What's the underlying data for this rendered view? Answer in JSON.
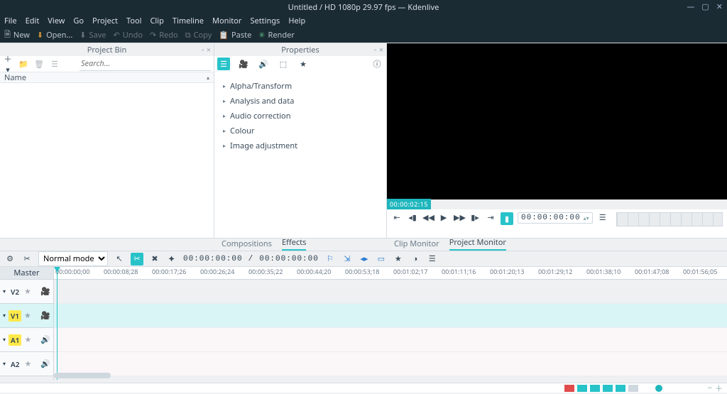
{
  "window": {
    "title": "Untitled / HD 1080p 29.97 fps — Kdenlive"
  },
  "menus": [
    "File",
    "Edit",
    "View",
    "Go",
    "Project",
    "Tool",
    "Clip",
    "Timeline",
    "Monitor",
    "Settings",
    "Help"
  ],
  "toolbar": {
    "new": "New",
    "open": "Open...",
    "save": "Save",
    "undo": "Undo",
    "redo": "Redo",
    "copy": "Copy",
    "paste": "Paste",
    "render": "Render"
  },
  "bin": {
    "title": "Project Bin",
    "search_placeholder": "Search...",
    "col_name": "Name"
  },
  "properties": {
    "title": "Properties",
    "categories": [
      "Alpha/Transform",
      "Analysis and data",
      "Audio correction",
      "Colour",
      "Image adjustment"
    ],
    "tab_compositions": "Compositions",
    "tab_effects": "Effects"
  },
  "monitor": {
    "badge": "00:00:02:15",
    "timecode": "00:00:00:00",
    "tab_clip": "Clip Monitor",
    "tab_project": "Project Monitor"
  },
  "tl_toolbar": {
    "mode": "Normal mode",
    "tc_now": "00:00:00:00",
    "tc_sep": " / ",
    "tc_dur": "00:00:00:00"
  },
  "tracks": {
    "master": "Master",
    "v2": "V2",
    "v1": "V1",
    "a1": "A1",
    "a2": "A2"
  },
  "ruler": [
    "00:00:00;00",
    "00:00:08;28",
    "00:00:17;26",
    "00:00:26;24",
    "00:00:35;22",
    "00:00:44;20",
    "00:00:53;18",
    "00:01:02;17",
    "00:01:11;16",
    "00:01:20;13",
    "00:01:29;12",
    "00:01:38;10",
    "00:01:47;08",
    "00:01:56;05"
  ]
}
